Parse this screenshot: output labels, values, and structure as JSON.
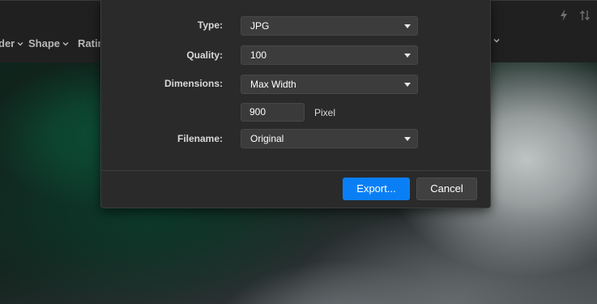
{
  "toolbar": {
    "filters": [
      {
        "label": "der"
      },
      {
        "label": "Shape"
      },
      {
        "label": "Ratin"
      }
    ],
    "icons": [
      "lightning-icon",
      "sort-icon"
    ]
  },
  "dialog": {
    "fields": {
      "type": {
        "label": "Type:",
        "value": "JPG"
      },
      "quality": {
        "label": "Quality:",
        "value": "100"
      },
      "dimensions": {
        "label": "Dimensions:",
        "value": "Max Width"
      },
      "size": {
        "value": "900",
        "unit": "Pixel"
      },
      "filename": {
        "label": "Filename:",
        "value": "Original"
      }
    },
    "buttons": {
      "export": "Export...",
      "cancel": "Cancel"
    }
  },
  "colors": {
    "accent": "#0a7ff5",
    "dialog_bg": "#2a2a2a",
    "field_bg": "#3c3c3c"
  }
}
